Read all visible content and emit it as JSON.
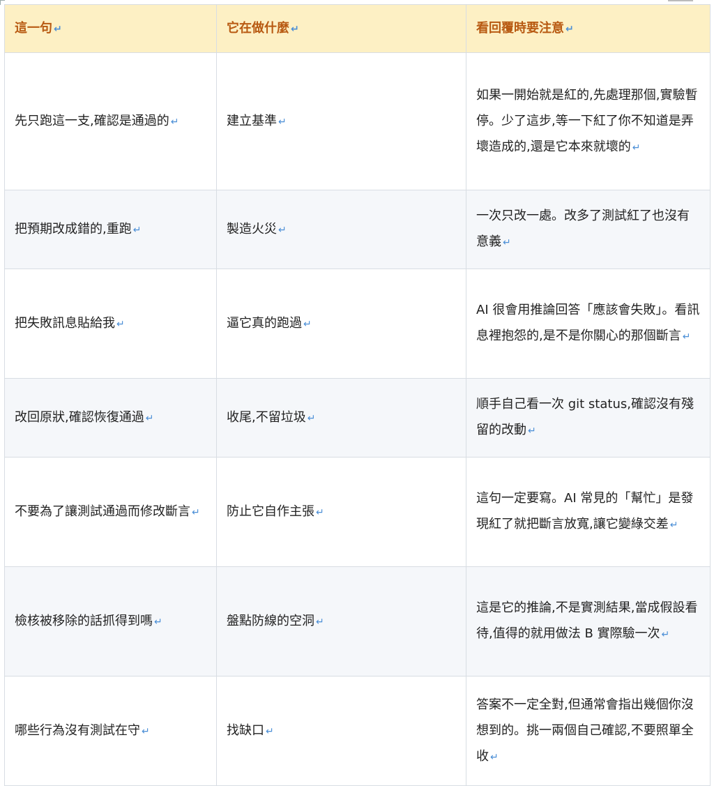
{
  "table": {
    "headers": [
      "這一句",
      "它在做什麼",
      "看回覆時要注意"
    ],
    "rows": [
      {
        "sentence": "先只跑這一支,確認是通過的",
        "purpose": "建立基準",
        "note": "如果一開始就是紅的,先處理那個,實驗暫停。少了這步,等一下紅了你不知道是弄壞造成的,還是它本來就壞的"
      },
      {
        "sentence": "把預期改成錯的,重跑",
        "purpose": "製造火災",
        "note": "一次只改一處。改多了測試紅了也沒有意義"
      },
      {
        "sentence": "把失敗訊息貼給我",
        "purpose": "逼它真的跑過",
        "note": "AI 很會用推論回答「應該會失敗」。看訊息裡抱怨的,是不是你關心的那個斷言"
      },
      {
        "sentence": "改回原狀,確認恢復通過",
        "purpose": "收尾,不留垃圾",
        "note": "順手自己看一次 git status,確認沒有殘留的改動"
      },
      {
        "sentence": "不要為了讓測試通過而修改斷言",
        "purpose": "防止它自作主張",
        "note": "這句一定要寫。AI 常見的「幫忙」是發現紅了就把斷言放寬,讓它變綠交差"
      },
      {
        "sentence": "檢核被移除的話抓得到嗎",
        "purpose": "盤點防線的空洞",
        "note": "這是它的推論,不是實測結果,當成假設看待,值得的就用做法 B 實際驗一次"
      },
      {
        "sentence": "哪些行為沒有測試在守",
        "purpose": "找缺口",
        "note": "答案不一定全對,但通常會指出幾個你沒想到的。挑一兩個自己確認,不要照單全收"
      }
    ]
  },
  "paragraph_mark": "↵",
  "colors": {
    "header_bg": "#fdf0c4",
    "header_text": "#b85a12",
    "alt_row_bg": "#f5f7fa",
    "border": "#d8dde3",
    "mark": "#4a8ed6"
  }
}
